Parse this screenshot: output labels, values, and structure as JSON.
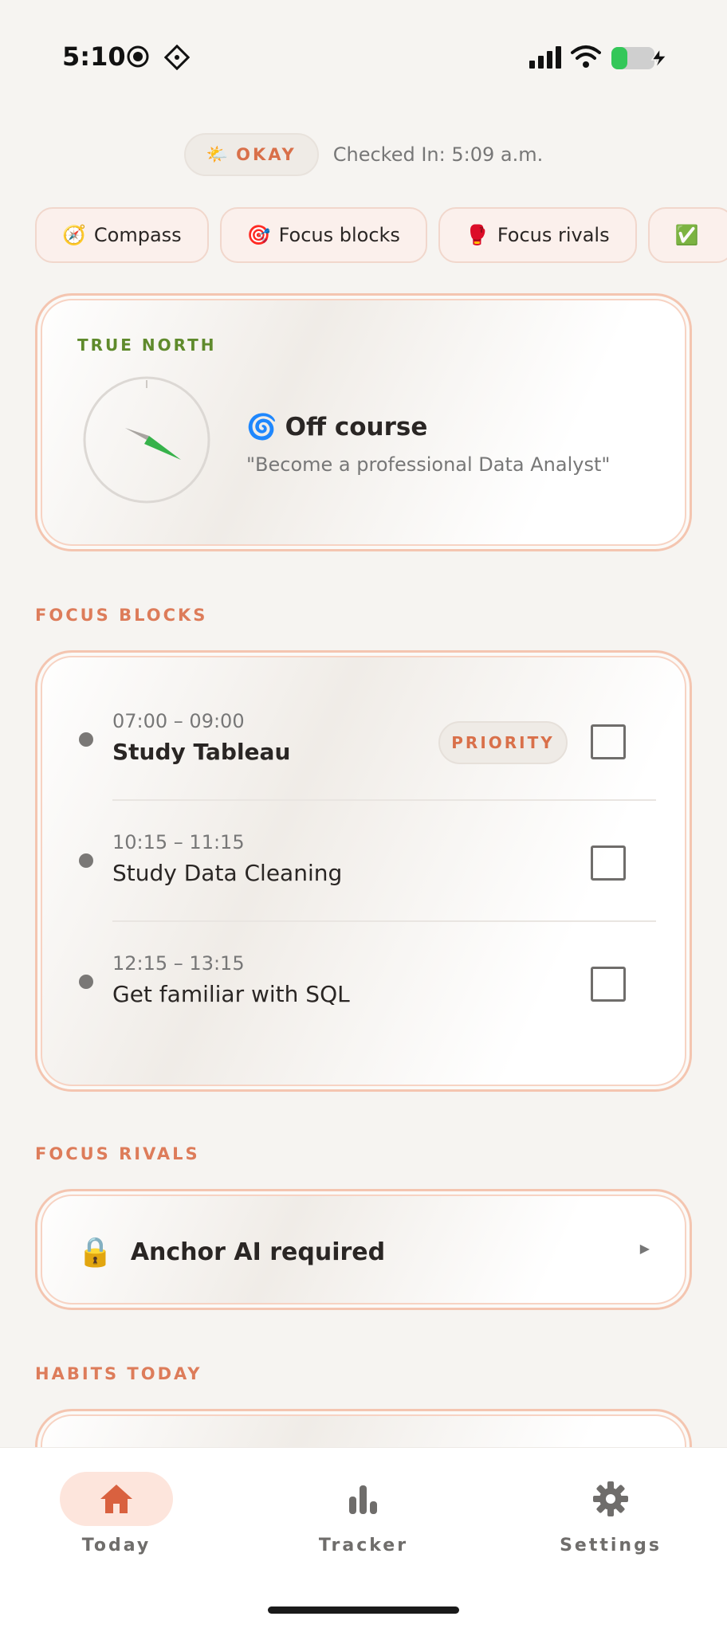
{
  "status_bar": {
    "time": "5:10",
    "icons": [
      "record-icon",
      "connectivity-icon",
      "signal-icon",
      "wifi-icon",
      "battery-charging-icon"
    ]
  },
  "checkin": {
    "mood_emoji": "🌤️",
    "mood_label": "OKAY",
    "checked_in_text": "Checked In: 5:09 a.m."
  },
  "chips": [
    {
      "emoji": "🧭",
      "label": "Compass"
    },
    {
      "emoji": "🎯",
      "label": "Focus blocks"
    },
    {
      "emoji": "🥊",
      "label": "Focus rivals"
    },
    {
      "emoji": "✅",
      "label": ""
    }
  ],
  "true_north": {
    "label": "TRUE NORTH",
    "status_emoji": "🌀",
    "status": "Off course",
    "goal": "\"Become a professional Data Analyst\""
  },
  "focus_blocks": {
    "section_label": "FOCUS BLOCKS",
    "items": [
      {
        "time": "07:00 – 09:00",
        "title": "Study Tableau",
        "badge": "PRIORITY"
      },
      {
        "time": "10:15 – 11:15",
        "title": "Study Data Cleaning"
      },
      {
        "time": "12:15 – 13:15",
        "title": "Get familiar with SQL"
      }
    ]
  },
  "focus_rivals": {
    "section_label": "FOCUS RIVALS",
    "lock_emoji": "🔒",
    "text": "Anchor AI required"
  },
  "habits": {
    "section_label": "HABITS TODAY"
  },
  "tabbar": {
    "items": [
      {
        "label": "Today",
        "icon": "home-icon",
        "active": true
      },
      {
        "label": "Tracker",
        "icon": "bar-chart-icon",
        "active": false
      },
      {
        "label": "Settings",
        "icon": "gear-icon",
        "active": false
      }
    ]
  },
  "colors": {
    "accent": "#dd7c5a",
    "true_north_label": "#5f8a2c",
    "card_border": "#f4c5b0",
    "background": "#f6f4f1"
  }
}
